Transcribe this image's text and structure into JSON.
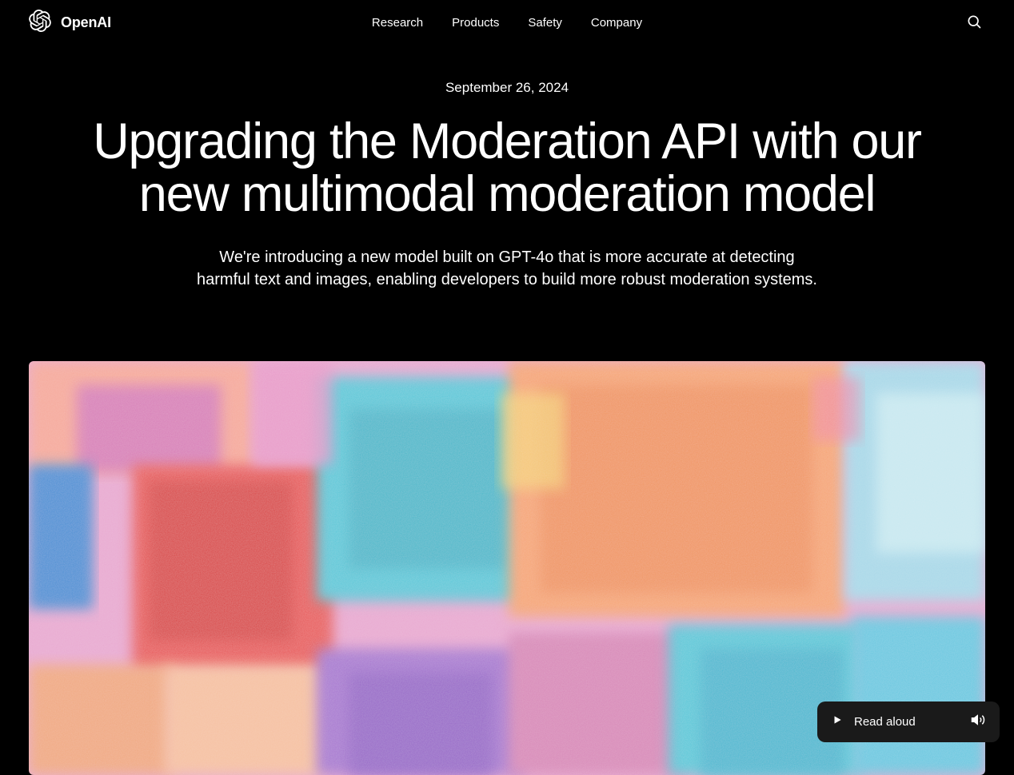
{
  "header": {
    "brand": "OpenAI",
    "nav": [
      "Research",
      "Products",
      "Safety",
      "Company"
    ]
  },
  "article": {
    "date": "September 26, 2024",
    "title": "Upgrading the Moderation API with our new multimodal moderation model",
    "subtitle": "We're introducing a new model built on GPT-4o that is more accurate at detecting harmful text and images, enabling developers to build more robust moderation systems."
  },
  "readAloud": {
    "label": "Read aloud"
  }
}
